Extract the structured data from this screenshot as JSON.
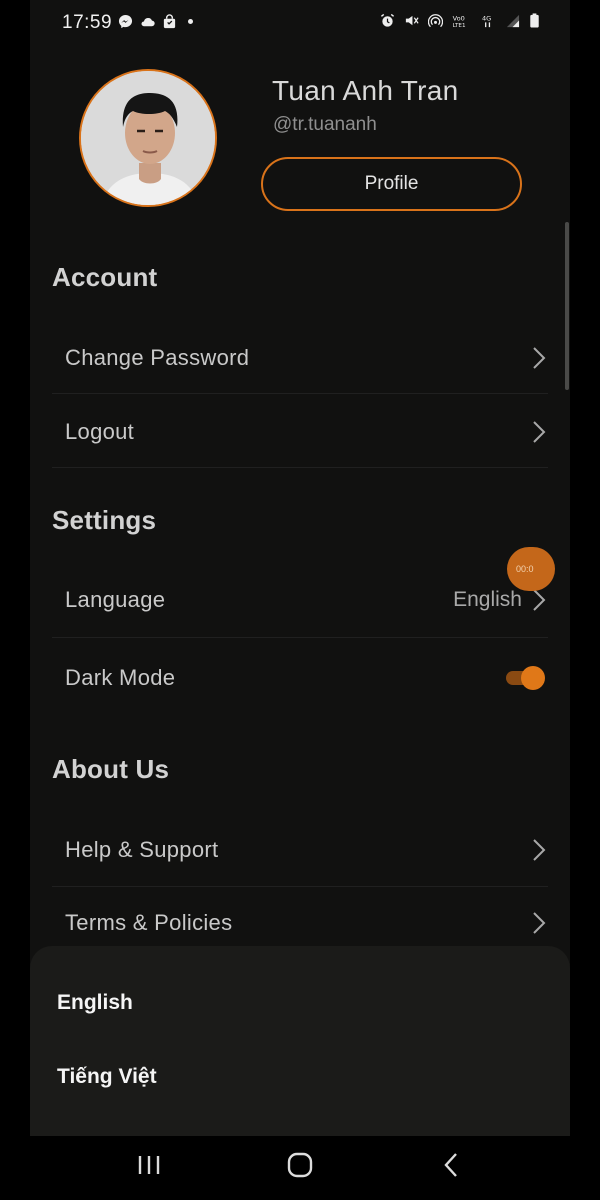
{
  "status_bar": {
    "time": "17:59",
    "left_icons": [
      "messenger-icon",
      "cloud-icon",
      "shopping-bag-icon",
      "dot-icon"
    ],
    "right_icons": [
      "alarm-icon",
      "mute-icon",
      "hotspot-icon",
      "volte-icon",
      "network-4g-icon",
      "signal-icon",
      "battery-icon"
    ]
  },
  "profile": {
    "name": "Tuan Anh Tran",
    "handle": "@tr.tuananh",
    "button_label": "Profile"
  },
  "sections": {
    "account": {
      "title": "Account",
      "items": [
        {
          "label": "Change Password"
        },
        {
          "label": "Logout"
        }
      ]
    },
    "settings": {
      "title": "Settings",
      "language": {
        "label": "Language",
        "value": "English"
      },
      "dark_mode": {
        "label": "Dark Mode",
        "enabled": true
      }
    },
    "about": {
      "title": "About Us",
      "items": [
        {
          "label": "Help & Support"
        },
        {
          "label": "Terms & Policies"
        }
      ]
    }
  },
  "floating_bubble": {
    "text": "00:0"
  },
  "language_sheet": {
    "options": [
      "English",
      "Tiếng Việt"
    ]
  },
  "colors": {
    "accent": "#d9731a",
    "background": "#111110",
    "sheet": "#1b1b19"
  }
}
